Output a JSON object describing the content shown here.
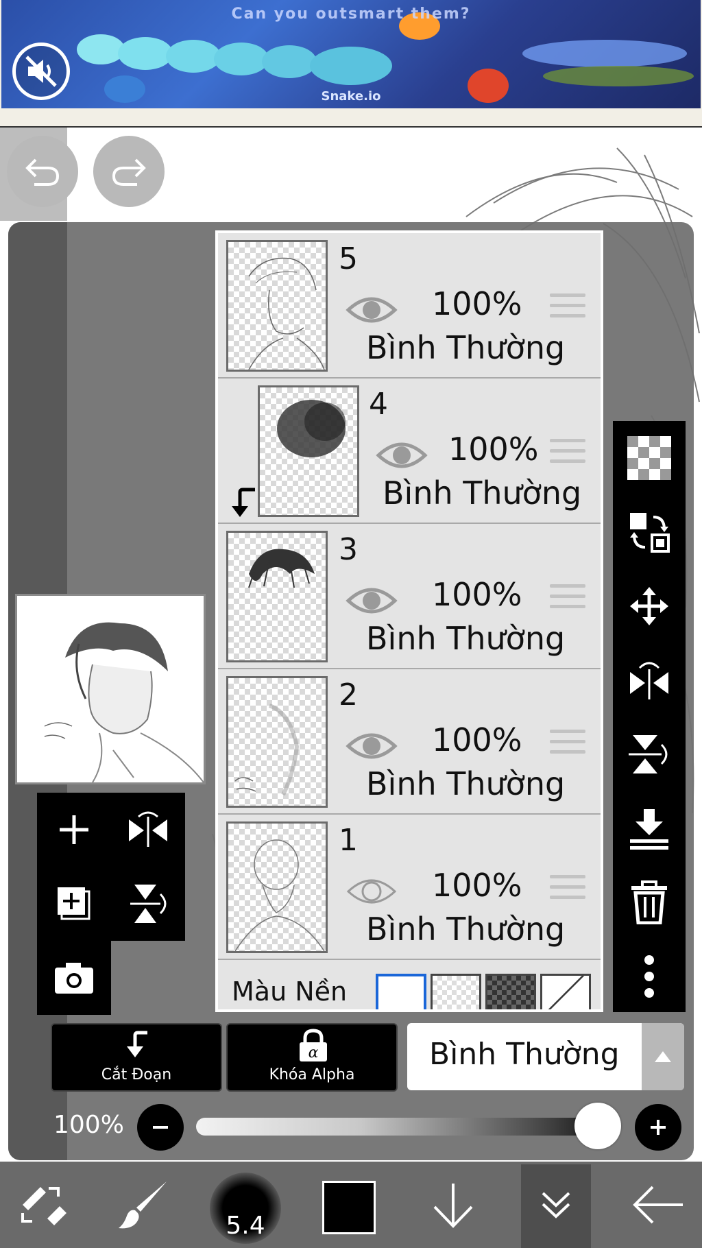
{
  "ad": {
    "headline": "Can you outsmart them?",
    "brand": "Snake.io",
    "mute_icon": "speaker-muted-icon"
  },
  "history": {
    "undo_icon": "undo-icon",
    "redo_icon": "redo-icon"
  },
  "layers": [
    {
      "number": "5",
      "opacity": "100%",
      "blend": "Bình Thường",
      "visible": true,
      "clipped": false
    },
    {
      "number": "4",
      "opacity": "100%",
      "blend": "Bình Thường",
      "visible": true,
      "clipped": true
    },
    {
      "number": "3",
      "opacity": "100%",
      "blend": "Bình Thường",
      "visible": true,
      "clipped": false
    },
    {
      "number": "2",
      "opacity": "100%",
      "blend": "Bình Thường",
      "visible": true,
      "clipped": false
    },
    {
      "number": "1",
      "opacity": "100%",
      "blend": "Bình Thường",
      "visible": false,
      "clipped": false
    }
  ],
  "background": {
    "label": "Màu Nền"
  },
  "left_tools": [
    "add-layer-icon",
    "flip-horizontal-icon",
    "duplicate-layer-icon",
    "flip-vertical-icon",
    "camera-icon"
  ],
  "right_tools": [
    "transparency-icon",
    "swap-layers-icon",
    "move-icon",
    "flip-horizontal-icon",
    "flip-vertical-icon",
    "merge-down-icon",
    "trash-icon",
    "more-icon"
  ],
  "controls": {
    "clip_label": "Cắt Đoạn",
    "alpha_lock_label": "Khóa Alpha",
    "blend_mode": "Bình Thường",
    "opacity_label": "100%",
    "opacity_value": 1.0
  },
  "bottom_bar": {
    "brush_size": "5.4",
    "color": "#000000",
    "items": [
      "transform-tool-icon",
      "brush-icon",
      "brush-size-icon",
      "color-icon",
      "down-arrow-icon",
      "layers-icon",
      "back-arrow-icon"
    ]
  }
}
